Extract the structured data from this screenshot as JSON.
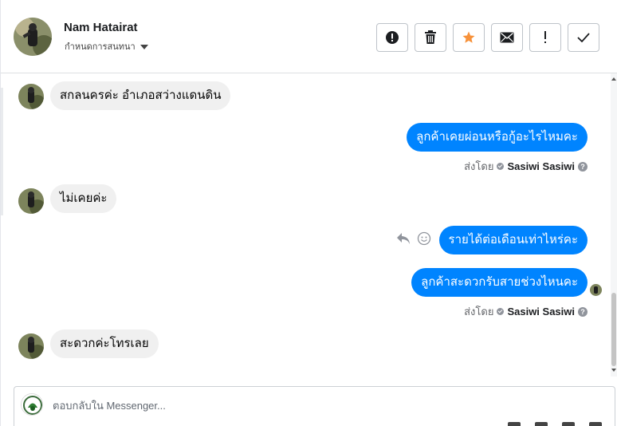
{
  "header": {
    "name": "Nam Hatairat",
    "subtitle": "กำหนดการสนทนา",
    "actions": [
      {
        "icon": "alert-circle-icon"
      },
      {
        "icon": "trash-icon"
      },
      {
        "icon": "star-icon"
      },
      {
        "icon": "envelope-icon"
      },
      {
        "icon": "exclamation-icon"
      },
      {
        "icon": "checkmark-icon"
      }
    ]
  },
  "colors": {
    "outgoing_bubble": "#0084ff",
    "incoming_bubble": "#f0f0f0",
    "star": "#f7923b"
  },
  "messages": [
    {
      "direction": "in",
      "text": "สกลนครค่ะ อำเภอสว่างแดนดิน"
    },
    {
      "direction": "out",
      "text": "ลูกค้าเคยผ่อนหรือกู้อะไรไหมคะ",
      "sent_by_label": "ส่งโดย",
      "sender": "Sasiwi Sasiwi"
    },
    {
      "direction": "in",
      "text": "ไม่เคยค่ะ"
    },
    {
      "direction": "out",
      "text": "รายได้ต่อเดือนเท่าไหร่คะ"
    },
    {
      "direction": "out",
      "text": "ลูกค้าสะดวกรับสายช่วงไหนคะ",
      "sent_by_label": "ส่งโดย",
      "sender": "Sasiwi Sasiwi"
    },
    {
      "direction": "in",
      "text": "สะดวกค่ะโทรเลย"
    }
  ],
  "composer": {
    "placeholder": "ตอบกลับใน Messenger..."
  }
}
